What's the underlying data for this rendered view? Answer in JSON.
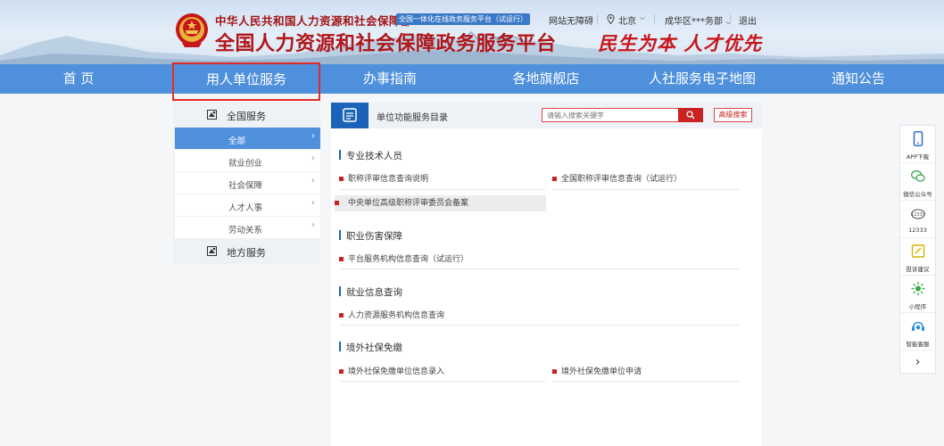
{
  "header": {
    "ministry": "中华人民共和国人力资源和社会保障部",
    "tag": "全国一体化在线政务服务平台（试运行）",
    "site_title": "全国人力资源和社会保障政务服务平台",
    "slogan": "民生为本 人才优先",
    "links": {
      "accessibility": "网站无障碍",
      "city": "北京",
      "user": "成华区***务部",
      "logout": "退出"
    }
  },
  "nav": [
    "首 页",
    "用人单位服务",
    "办事指南",
    "各地旗舰店",
    "人社服务电子地图",
    "通知公告"
  ],
  "sidebar": {
    "national": "全国服务",
    "items": [
      "全部",
      "就业创业",
      "社会保障",
      "人才人事",
      "劳动关系"
    ],
    "local": "地方服务"
  },
  "main": {
    "title": "单位功能服务目录",
    "search_placeholder": "请输入搜索关键字",
    "advanced": "高级搜索",
    "sections": [
      {
        "title": "专业技术人员",
        "links": [
          "职称评审信息查询说明",
          "全国职称评审信息查询（试运行）",
          "中央单位高级职称评审委员会备案"
        ]
      },
      {
        "title": "职业伤害保障",
        "links": [
          "平台服务机构信息查询（试运行）"
        ]
      },
      {
        "title": "就业信息查询",
        "links": [
          "人力资源服务机构信息查询"
        ]
      },
      {
        "title": "境外社保免缴",
        "links": [
          "境外社保免缴单位信息录入",
          "境外社保免缴单位申请"
        ]
      }
    ]
  },
  "float": {
    "items": [
      "APP下载",
      "微信公众号",
      "12333",
      "投诉建议",
      "小程序",
      "智能客服"
    ],
    "icons": [
      "phone-icon",
      "wechat-icon",
      "hotline-icon",
      "feedback-icon",
      "mini-program-icon",
      "customer-service-icon"
    ]
  },
  "colors": {
    "nav_blue": "#4f90dd",
    "brand_red": "#b0161a",
    "accent_blue": "#1b63b8"
  }
}
